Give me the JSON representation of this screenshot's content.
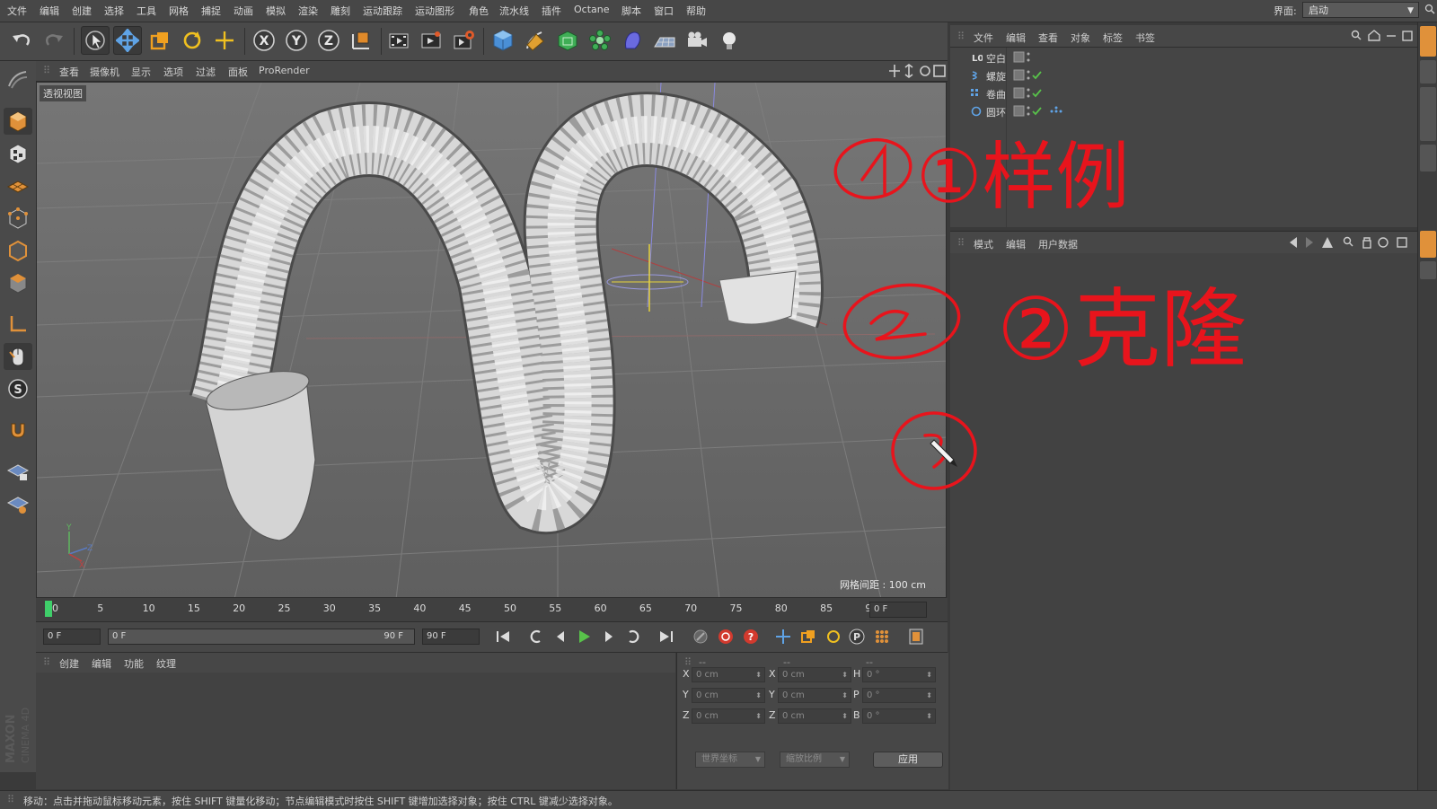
{
  "menubar": {
    "items": [
      "文件",
      "编辑",
      "创建",
      "选择",
      "工具",
      "网格",
      "捕捉",
      "动画",
      "模拟",
      "渲染",
      "雕刻",
      "运动跟踪",
      "运动图形",
      "角色",
      "流水线",
      "插件",
      "Octane",
      "脚本",
      "窗口",
      "帮助"
    ],
    "interface_label": "界面:",
    "interface_value": "启动"
  },
  "toolbar": {
    "icons": [
      "undo-icon",
      "redo-icon",
      "select-icon",
      "move-icon",
      "scale-icon",
      "rotate-icon",
      "live-select-icon",
      "x-axis-icon",
      "y-axis-icon",
      "z-axis-icon",
      "coord-system-icon",
      "render-view-icon",
      "render-picture-icon",
      "render-settings-icon",
      "cube-icon",
      "pen-icon",
      "subdivision-icon",
      "cloner-icon",
      "deformer-icon",
      "floor-icon",
      "camera-icon",
      "light-icon"
    ],
    "axis_labels": [
      "X",
      "Y",
      "Z"
    ]
  },
  "viewport": {
    "menu": [
      "查看",
      "摄像机",
      "显示",
      "选项",
      "过滤",
      "面板",
      "ProRender"
    ],
    "label": "透视视图",
    "grid_spacing": "网格间距 : 100 cm",
    "axis_labels": [
      "Y",
      "Z",
      "X"
    ]
  },
  "timeline": {
    "ticks": [
      "0",
      "5",
      "10",
      "15",
      "20",
      "25",
      "30",
      "35",
      "40",
      "45",
      "50",
      "55",
      "60",
      "65",
      "70",
      "75",
      "80",
      "85",
      "90"
    ],
    "current_frame": "0 F"
  },
  "playback": {
    "start_field": "0 F",
    "range_start": "0 F",
    "range_end": "90 F",
    "end_field": "90 F"
  },
  "material": {
    "menu": [
      "创建",
      "编辑",
      "功能",
      "纹理"
    ]
  },
  "coords": {
    "headers": [
      "--",
      "--",
      "--"
    ],
    "rows": [
      {
        "l1": "X",
        "v1": "0 cm",
        "l2": "X",
        "v2": "0 cm",
        "l3": "H",
        "v3": "0 °"
      },
      {
        "l1": "Y",
        "v1": "0 cm",
        "l2": "Y",
        "v2": "0 cm",
        "l3": "P",
        "v3": "0 °"
      },
      {
        "l1": "Z",
        "v1": "0 cm",
        "l2": "Z",
        "v2": "0 cm",
        "l3": "B",
        "v3": "0 °"
      }
    ],
    "mode_dropdown": "世界坐标",
    "scale_dropdown": "缩放比例",
    "apply": "应用"
  },
  "object_manager": {
    "menu": [
      "文件",
      "编辑",
      "查看",
      "对象",
      "标签",
      "书签"
    ],
    "objects": [
      {
        "name": "空白",
        "icon": "null-icon"
      },
      {
        "name": "螺旋",
        "icon": "helix-icon"
      },
      {
        "name": "卷曲",
        "icon": "sweep-icon"
      },
      {
        "name": "圆环",
        "icon": "circle-icon"
      }
    ]
  },
  "attribute_manager": {
    "menu": [
      "模式",
      "编辑",
      "用户数据"
    ]
  },
  "status_bar": "移动：点击并拖动鼠标移动元素，按住 SHIFT 键量化移动；节点编辑模式时按住 SHIFT 键增加选择对象；按住 CTRL 键减少选择对象。",
  "branding": "MAXON CINEMA 4D",
  "annotations": {
    "line1": "①样例",
    "line2": "②克隆",
    "line3": "③",
    "color": "#e8141c"
  },
  "colors": {
    "accent_blue": "#5fa3e6",
    "timeline_marker": "#3fcf6a",
    "play_green": "#58c24a",
    "record_red": "#d23a2e"
  }
}
